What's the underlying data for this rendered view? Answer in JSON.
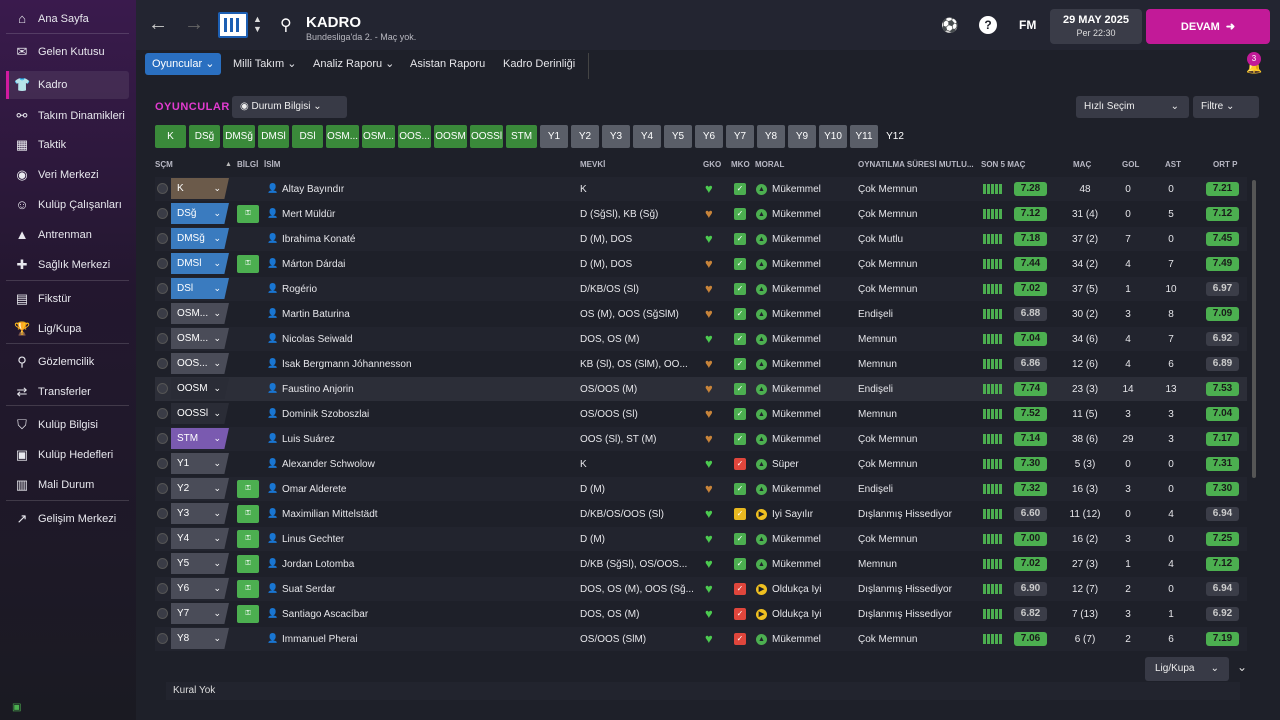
{
  "sidebar": {
    "items": [
      {
        "label": "Ana Sayfa",
        "icon": "home-icon",
        "glyph": "⌂"
      },
      {
        "label": "Gelen Kutusu",
        "icon": "inbox-icon",
        "glyph": "✉"
      },
      {
        "label": "Kadro",
        "icon": "shirt-icon",
        "glyph": "👕"
      },
      {
        "label": "Takım Dinamikleri",
        "icon": "dynamics-icon",
        "glyph": "⚯"
      },
      {
        "label": "Taktik",
        "icon": "tactics-icon",
        "glyph": "▦"
      },
      {
        "label": "Veri Merkezi",
        "icon": "data-icon",
        "glyph": "◉"
      },
      {
        "label": "Kulüp Çalışanları",
        "icon": "staff-icon",
        "glyph": "☺"
      },
      {
        "label": "Antrenman",
        "icon": "training-icon",
        "glyph": "▲"
      },
      {
        "label": "Sağlık Merkezi",
        "icon": "medical-icon",
        "glyph": "✚"
      },
      {
        "label": "Fikstür",
        "icon": "calendar-icon",
        "glyph": "▤"
      },
      {
        "label": "Lig/Kupa",
        "icon": "trophy-icon",
        "glyph": "🏆"
      },
      {
        "label": "Gözlemcilik",
        "icon": "scouting-icon",
        "glyph": "⚲"
      },
      {
        "label": "Transferler",
        "icon": "transfers-icon",
        "glyph": "⇄"
      },
      {
        "label": "Kulüp Bilgisi",
        "icon": "shield-icon",
        "glyph": "⛉"
      },
      {
        "label": "Kulüp Hedefleri",
        "icon": "briefcase-icon",
        "glyph": "▣"
      },
      {
        "label": "Mali Durum",
        "icon": "finance-icon",
        "glyph": "▥"
      },
      {
        "label": "Gelişim Merkezi",
        "icon": "development-icon",
        "glyph": "↗"
      }
    ]
  },
  "header": {
    "title": "KADRO",
    "subtitle": "Bundesliga'da 2. - Maç yok.",
    "fm": "FM",
    "date": "29 MAY 2025",
    "time": "Per 22:30",
    "continue": "DEVAM",
    "notif_count": "3"
  },
  "tabs": [
    "Oyuncular",
    "Milli Takım",
    "Analiz Raporu",
    "Asistan Raporu",
    "Kadro Derinliği"
  ],
  "section_title": "OYUNCULAR",
  "status_dd": "Durum Bilgisi",
  "quick_pick": "Hızlı Seçim",
  "filter": "Filtre",
  "positions": [
    "K",
    "DSğ",
    "DMSğ",
    "DMSl",
    "DSl",
    "OSM...",
    "OSM...",
    "OOS...",
    "OOSM",
    "OOSSl",
    "STM",
    "Y1",
    "Y2",
    "Y3",
    "Y4",
    "Y5",
    "Y6",
    "Y7",
    "Y8",
    "Y9",
    "Y10",
    "Y11",
    "Y12"
  ],
  "columns": {
    "sec": "SÇM",
    "bilgi": "BİLGİ",
    "isim": "İSİM",
    "mevki": "MEVKİ",
    "gko": "GKO",
    "mko": "MKO",
    "moral": "MORAL",
    "oyn": "OYNATILMA SÜRESİ MUTLU...",
    "son5": "SON 5 MAÇ",
    "mac": "MAÇ",
    "gol": "GOL",
    "ast": "AST",
    "ort": "ORT P"
  },
  "players": [
    {
      "pos": "K",
      "posColor": "#6b5a4a",
      "bilgi": false,
      "name": "Altay Bayındır",
      "mevki": "K",
      "gko": "green",
      "mko": "green",
      "moral": "Mükemmel",
      "moralColor": "#4caf50",
      "oyn": "Çok Memnun",
      "son5": "7.28",
      "mac": "48",
      "gol": "0",
      "ast": "0",
      "ort": "7.21",
      "ortGreen": true
    },
    {
      "pos": "DSğ",
      "posColor": "#3a7bbf",
      "bilgi": true,
      "name": "Mert Müldür",
      "mevki": "D (SğSl), KB (Sğ)",
      "gko": "brown",
      "mko": "green",
      "moral": "Mükemmel",
      "moralColor": "#4caf50",
      "oyn": "Çok Memnun",
      "son5": "7.12",
      "mac": "31 (4)",
      "gol": "0",
      "ast": "5",
      "ort": "7.12",
      "ortGreen": true
    },
    {
      "pos": "DMSğ",
      "posColor": "#3a7bbf",
      "bilgi": false,
      "name": "Ibrahima Konaté",
      "mevki": "D (M), DOS",
      "gko": "green",
      "mko": "green",
      "moral": "Mükemmel",
      "moralColor": "#4caf50",
      "oyn": "Çok Mutlu",
      "son5": "7.18",
      "mac": "37 (2)",
      "gol": "7",
      "ast": "0",
      "ort": "7.45",
      "ortGreen": true
    },
    {
      "pos": "DMSl",
      "posColor": "#3a7bbf",
      "bilgi": true,
      "name": "Márton Dárdai",
      "mevki": "D (M), DOS",
      "gko": "brown",
      "mko": "green",
      "moral": "Mükemmel",
      "moralColor": "#4caf50",
      "oyn": "Çok Memnun",
      "son5": "7.44",
      "mac": "34 (2)",
      "gol": "4",
      "ast": "7",
      "ort": "7.49",
      "ortGreen": true
    },
    {
      "pos": "DSl",
      "posColor": "#3a7bbf",
      "bilgi": false,
      "name": "Rogério",
      "mevki": "D/KB/OS (Sl)",
      "gko": "brown",
      "mko": "green",
      "moral": "Mükemmel",
      "moralColor": "#4caf50",
      "oyn": "Çok Memnun",
      "son5": "7.02",
      "mac": "37 (5)",
      "gol": "1",
      "ast": "10",
      "ort": "6.97",
      "ortGreen": false
    },
    {
      "pos": "OSM...",
      "posColor": "#4a4c58",
      "bilgi": false,
      "name": "Martin Baturina",
      "mevki": "OS (M), OOS (SğSlM)",
      "gko": "brown",
      "mko": "green",
      "moral": "Mükemmel",
      "moralColor": "#4caf50",
      "oyn": "Endişeli",
      "son5": "6.88",
      "mac": "30 (2)",
      "gol": "3",
      "ast": "8",
      "ort": "7.09",
      "ortGreen": true
    },
    {
      "pos": "OSM...",
      "posColor": "#4a4c58",
      "bilgi": false,
      "name": "Nicolas Seiwald",
      "mevki": "DOS, OS (M)",
      "gko": "green",
      "mko": "green",
      "moral": "Mükemmel",
      "moralColor": "#4caf50",
      "oyn": "Memnun",
      "son5": "7.04",
      "mac": "34 (6)",
      "gol": "4",
      "ast": "7",
      "ort": "6.92",
      "ortGreen": false
    },
    {
      "pos": "OOS...",
      "posColor": "#4a4c58",
      "bilgi": false,
      "name": "Ísak Bergmann Jóhannesson",
      "mevki": "KB (Sl), OS (SlM), OO...",
      "gko": "brown",
      "mko": "green",
      "moral": "Mükemmel",
      "moralColor": "#4caf50",
      "oyn": "Memnun",
      "son5": "6.86",
      "mac": "12 (6)",
      "gol": "4",
      "ast": "6",
      "ort": "6.89",
      "ortGreen": false
    },
    {
      "pos": "OOSM",
      "posColor": "#2a2c36",
      "bilgi": false,
      "name": "Faustino Anjorin",
      "mevki": "OS/OOS (M)",
      "gko": "brown",
      "mko": "green",
      "moral": "Mükemmel",
      "moralColor": "#4caf50",
      "oyn": "Endişeli",
      "son5": "7.74",
      "mac": "23 (3)",
      "gol": "14",
      "ast": "13",
      "ort": "7.53",
      "ortGreen": true
    },
    {
      "pos": "OOSSl",
      "posColor": "#2a2c36",
      "bilgi": false,
      "name": "Dominik Szoboszlai",
      "mevki": "OS/OOS (Sl)",
      "gko": "brown",
      "mko": "green",
      "moral": "Mükemmel",
      "moralColor": "#4caf50",
      "oyn": "Memnun",
      "son5": "7.52",
      "mac": "11 (5)",
      "gol": "3",
      "ast": "3",
      "ort": "7.04",
      "ortGreen": true
    },
    {
      "pos": "STM",
      "posColor": "#7a5ab0",
      "bilgi": false,
      "name": "Luis Suárez",
      "mevki": "OOS (Sl), ST (M)",
      "gko": "brown",
      "mko": "green",
      "moral": "Mükemmel",
      "moralColor": "#4caf50",
      "oyn": "Çok Memnun",
      "son5": "7.14",
      "mac": "38 (6)",
      "gol": "29",
      "ast": "3",
      "ort": "7.17",
      "ortGreen": true
    },
    {
      "pos": "Y1",
      "posColor": "#4a4c58",
      "bilgi": false,
      "name": "Alexander Schwolow",
      "mevki": "K",
      "gko": "green",
      "mko": "red",
      "moral": "Süper",
      "moralColor": "#4caf50",
      "oyn": "Çok Memnun",
      "son5": "7.30",
      "mac": "5 (3)",
      "gol": "0",
      "ast": "0",
      "ort": "7.31",
      "ortGreen": true
    },
    {
      "pos": "Y2",
      "posColor": "#4a4c58",
      "bilgi": true,
      "name": "Omar Alderete",
      "mevki": "D (M)",
      "gko": "brown",
      "mko": "green",
      "moral": "Mükemmel",
      "moralColor": "#4caf50",
      "oyn": "Endişeli",
      "son5": "7.32",
      "mac": "16 (3)",
      "gol": "3",
      "ast": "0",
      "ort": "7.30",
      "ortGreen": true
    },
    {
      "pos": "Y3",
      "posColor": "#4a4c58",
      "bilgi": true,
      "name": "Maximilian Mittelstädt",
      "mevki": "D/KB/OS/OOS (Sl)",
      "gko": "green",
      "mko": "yellow",
      "moral": "İyi Sayılır",
      "moralColor": "#f0c020",
      "oyn": "Dışlanmış Hissediyor",
      "son5": "6.60",
      "mac": "11 (12)",
      "gol": "0",
      "ast": "4",
      "ort": "6.94",
      "ortGreen": false
    },
    {
      "pos": "Y4",
      "posColor": "#4a4c58",
      "bilgi": true,
      "name": "Linus Gechter",
      "mevki": "D (M)",
      "gko": "green",
      "mko": "green",
      "moral": "Mükemmel",
      "moralColor": "#4caf50",
      "oyn": "Çok Memnun",
      "son5": "7.00",
      "mac": "16 (2)",
      "gol": "3",
      "ast": "0",
      "ort": "7.25",
      "ortGreen": true
    },
    {
      "pos": "Y5",
      "posColor": "#4a4c58",
      "bilgi": true,
      "name": "Jordan Lotomba",
      "mevki": "D/KB (SğSl), OS/OOS...",
      "gko": "green",
      "mko": "green",
      "moral": "Mükemmel",
      "moralColor": "#4caf50",
      "oyn": "Memnun",
      "son5": "7.02",
      "mac": "27 (3)",
      "gol": "1",
      "ast": "4",
      "ort": "7.12",
      "ortGreen": true
    },
    {
      "pos": "Y6",
      "posColor": "#4a4c58",
      "bilgi": true,
      "name": "Suat Serdar",
      "mevki": "DOS, OS (M), OOS (Sğ...",
      "gko": "green",
      "mko": "red",
      "moral": "Oldukça İyi",
      "moralColor": "#f0c020",
      "oyn": "Dışlanmış Hissediyor",
      "son5": "6.90",
      "mac": "12 (7)",
      "gol": "2",
      "ast": "0",
      "ort": "6.94",
      "ortGreen": false
    },
    {
      "pos": "Y7",
      "posColor": "#4a4c58",
      "bilgi": true,
      "name": "Santiago Ascacíbar",
      "mevki": "DOS, OS (M)",
      "gko": "green",
      "mko": "red",
      "moral": "Oldukça İyi",
      "moralColor": "#f0c020",
      "oyn": "Dışlanmış Hissediyor",
      "son5": "6.82",
      "mac": "7 (13)",
      "gol": "3",
      "ast": "1",
      "ort": "6.92",
      "ortGreen": false
    },
    {
      "pos": "Y8",
      "posColor": "#4a4c58",
      "bilgi": false,
      "name": "Immanuel Pherai",
      "mevki": "OS/OOS (SlM)",
      "gko": "green",
      "mko": "red",
      "moral": "Mükemmel",
      "moralColor": "#4caf50",
      "oyn": "Çok Memnun",
      "son5": "7.06",
      "mac": "6 (7)",
      "gol": "2",
      "ast": "6",
      "ort": "7.19",
      "ortGreen": true
    }
  ],
  "footer": {
    "league_dd": "Lig/Kupa",
    "rule": "Kural Yok"
  },
  "colors": {
    "accent": "#c21a98",
    "tabActive": "#2a6fc0",
    "green": "#4caf50"
  }
}
